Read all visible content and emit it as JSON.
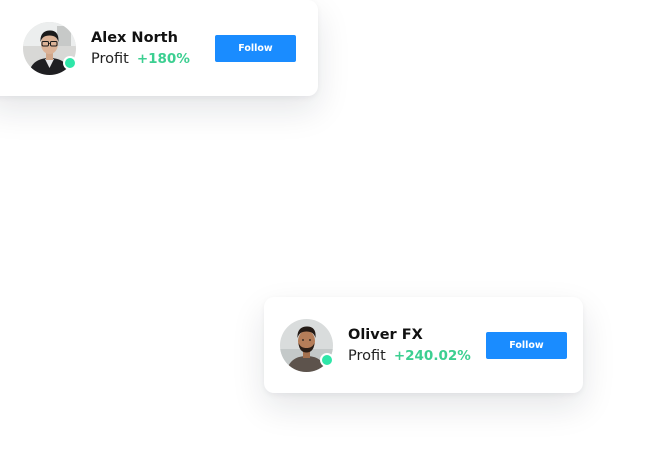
{
  "colors": {
    "button": "#1a8cff",
    "profit": "#3ccf91",
    "online": "#2ee6a8",
    "name": "#111111"
  },
  "traders": [
    {
      "name": "Alex North",
      "profit_label": "Profit",
      "profit_value": "+180%",
      "follow_label": "Follow",
      "online": true,
      "avatar_icon": "person-photo-glasses"
    },
    {
      "name": "Oliver FX",
      "profit_label": "Profit",
      "profit_value": "+240.02%",
      "follow_label": "Follow",
      "online": true,
      "avatar_icon": "person-photo-beard"
    }
  ]
}
